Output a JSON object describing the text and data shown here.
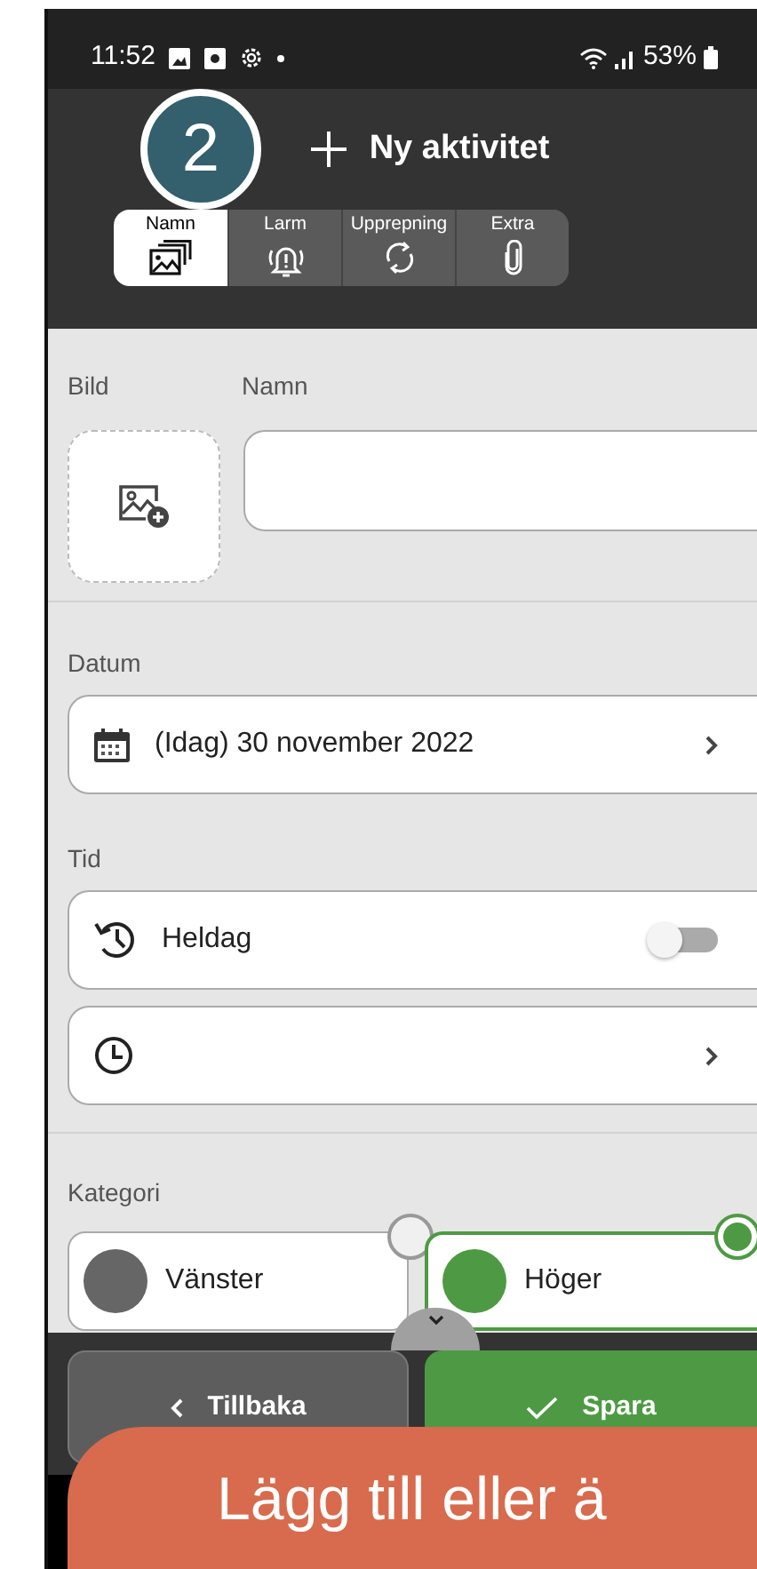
{
  "status_bar": {
    "time": "11:52",
    "battery": "53%"
  },
  "step_badge": "2",
  "header": {
    "title": "Ny aktivitet"
  },
  "tabs": [
    {
      "label": "Namn",
      "kind": "picture",
      "selected": true
    },
    {
      "label": "Larm",
      "kind": "alarm",
      "selected": false
    },
    {
      "label": "Upprepning",
      "kind": "repeat",
      "selected": false
    },
    {
      "label": "Extra",
      "kind": "attachment",
      "selected": false
    }
  ],
  "image": {
    "label": "Bild"
  },
  "name": {
    "label": "Namn"
  },
  "date": {
    "label": "Datum",
    "value": "(Idag) 30 november 2022"
  },
  "time": {
    "label": "Tid",
    "all_day": {
      "label": "Heldag",
      "on": false
    }
  },
  "category": {
    "label": "Kategori",
    "options": [
      {
        "label": "Vänster",
        "color": "#666666",
        "selected": false
      },
      {
        "label": "Höger",
        "color": "#4e9a44",
        "selected": true
      }
    ]
  },
  "buttons": [
    {
      "kind": "back",
      "label": "Tillbaka"
    },
    {
      "kind": "save",
      "label": "Spara"
    }
  ],
  "callout": "Lägg till eller ä"
}
